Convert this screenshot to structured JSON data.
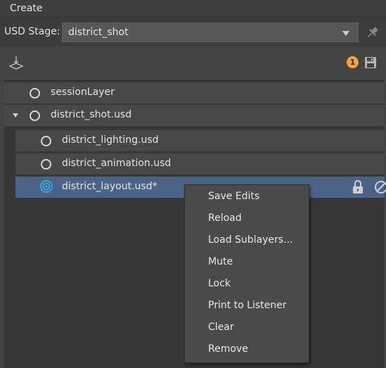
{
  "menubar": {
    "create_label": "Create"
  },
  "stage": {
    "label": "USD Stage:",
    "selected": "district_shot"
  },
  "toolbar": {
    "notification_count": "1"
  },
  "layers": [
    {
      "label": "sessionLayer"
    },
    {
      "label": "district_shot.usd"
    },
    {
      "label": "district_lighting.usd"
    },
    {
      "label": "district_animation.usd"
    },
    {
      "label": "district_layout.usd*"
    }
  ],
  "context_menu": {
    "items": [
      "Save Edits",
      "Reload",
      "Load Sublayers...",
      "Mute",
      "Lock",
      "Print to Listener",
      "Clear",
      "Remove"
    ]
  },
  "colors": {
    "selection": "#4a6387",
    "badge": "#f0a43a",
    "target_icon": "#3aa4d8"
  }
}
